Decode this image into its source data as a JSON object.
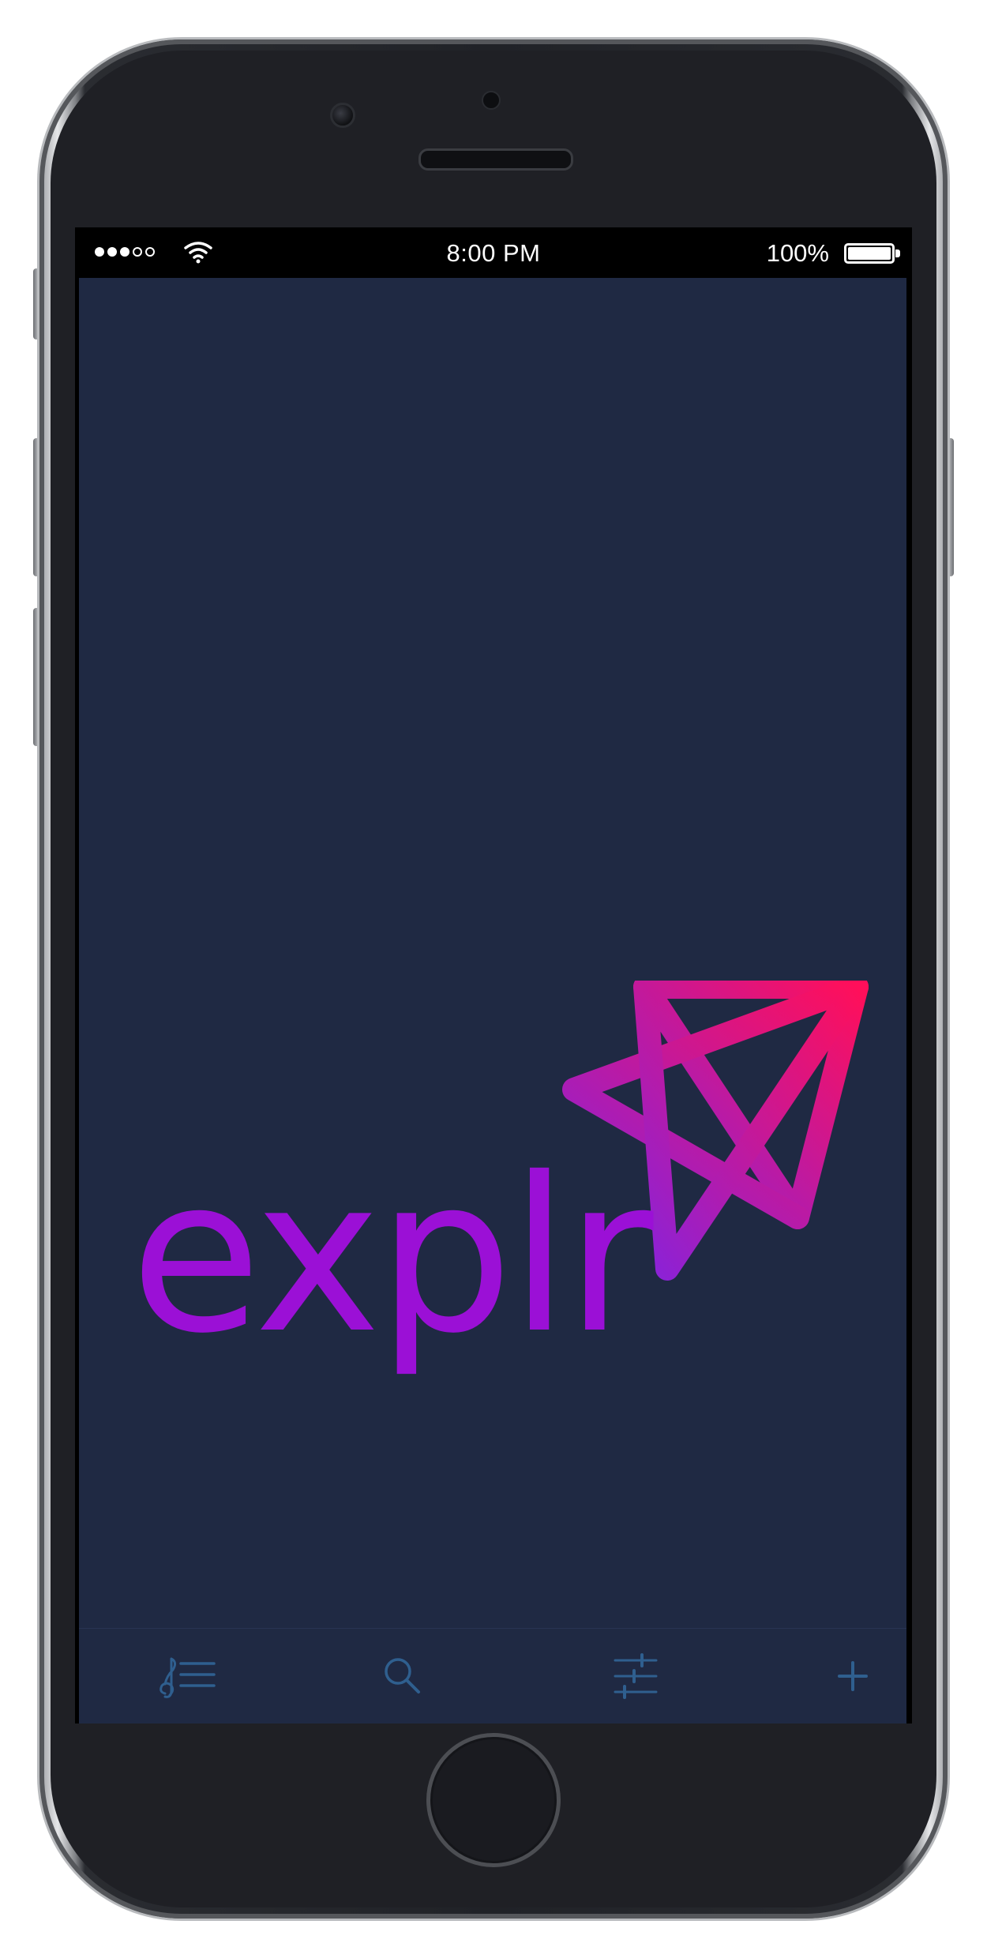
{
  "status_bar": {
    "time": "8:00 PM",
    "battery_percent": "100%",
    "signal_bars_filled": 3,
    "signal_bars_total": 5
  },
  "logo": {
    "wordmark": "explr",
    "color_text": "#9b10d6",
    "gradient_start": "#8a22d8",
    "gradient_end": "#ff0f5a"
  },
  "tab_bar": {
    "icon_color": "#2f5f8f",
    "tabs": [
      {
        "icon": "music-list-icon"
      },
      {
        "icon": "search-icon"
      },
      {
        "icon": "sliders-icon"
      },
      {
        "icon": "plus-icon"
      }
    ]
  },
  "colors": {
    "screen_background": "#1f2943",
    "status_bar_background": "#000000"
  }
}
